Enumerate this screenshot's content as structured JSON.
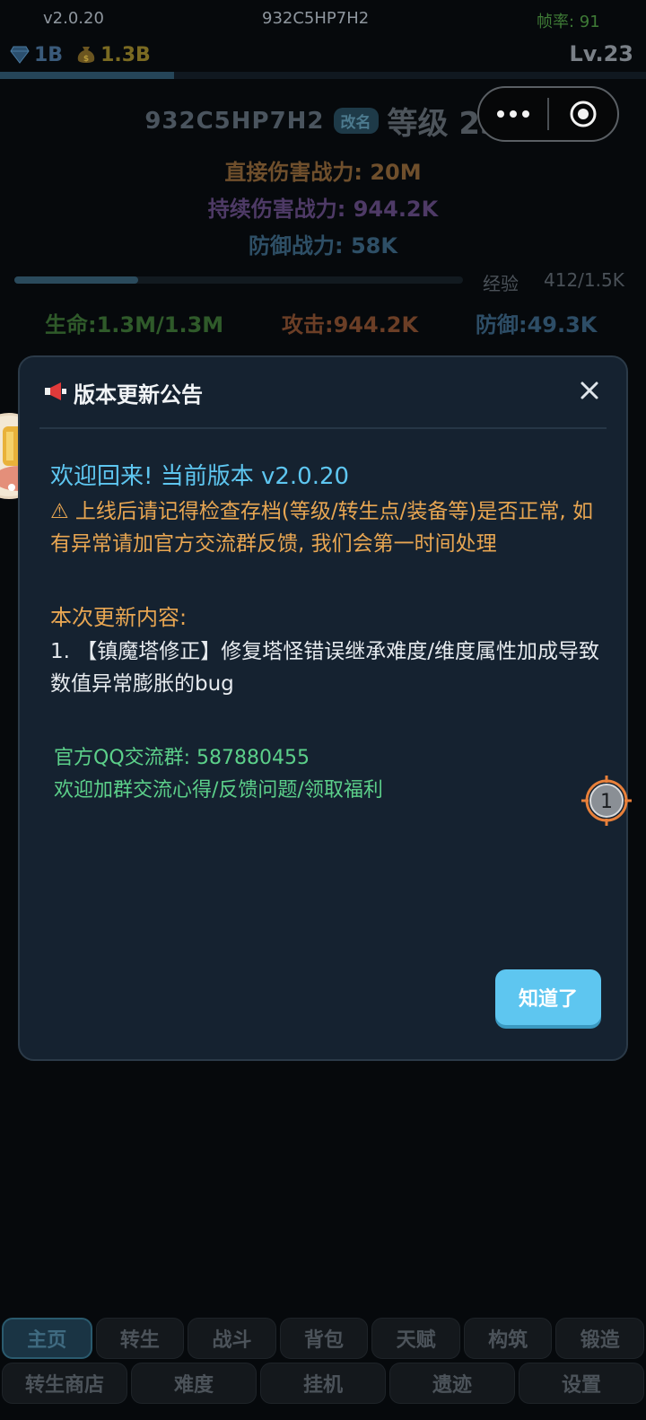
{
  "status_bar": {
    "version": "v2.0.20",
    "uid": "932C5HP7H2",
    "fps": "帧率: 91"
  },
  "currency": {
    "gems": "1B",
    "gold": "1.3B",
    "gem_icon": "diamond-icon",
    "gold_icon": "money-bag-icon"
  },
  "level_short": "Lv.23",
  "top_progress": 0.27,
  "player": {
    "id": "932C5HP7H2",
    "rename": "改名",
    "level_title": "等级 23"
  },
  "power": {
    "direct": "直接伤害战力: 20M",
    "dot": "持续伤害战力: 944.2K",
    "defense": "防御战力: 58K"
  },
  "exp": {
    "label": "经验",
    "value": "412/1.5K",
    "fraction": 0.275
  },
  "stats": {
    "hp": "生命:1.3M/1.3M",
    "attack": "攻击:944.2K",
    "defense": "防御:49.3K"
  },
  "modal": {
    "title": "版本更新公告",
    "title_icon": "megaphone-icon",
    "welcome": "欢迎回来! 当前版本 v2.0.20",
    "warning": "⚠ 上线后请记得检查存档(等级/转生点/装备等)是否正常, 如有异常请加官方交流群反馈, 我们会第一时间处理",
    "update_heading": "本次更新内容:",
    "update_item": "1. 【镇魔塔修正】修复塔怪错误继承难度/维度属性加成导致数值异常膨胀的bug",
    "qq_line": "官方QQ交流群: 587880455",
    "qq_sub": "欢迎加群交流心得/反馈问题/领取福利",
    "ok_button": "知道了"
  },
  "marker_label": "1",
  "nav": {
    "row1": [
      "主页",
      "转生",
      "战斗",
      "背包",
      "天赋",
      "构筑",
      "锻造"
    ],
    "row2": [
      "转生商店",
      "难度",
      "挂机",
      "遗迹",
      "设置"
    ],
    "active": "主页"
  },
  "colors": {
    "accent": "#5ec6f0",
    "warning": "#e8a652",
    "green": "#5cd08a",
    "modal_bg": "#152230"
  }
}
